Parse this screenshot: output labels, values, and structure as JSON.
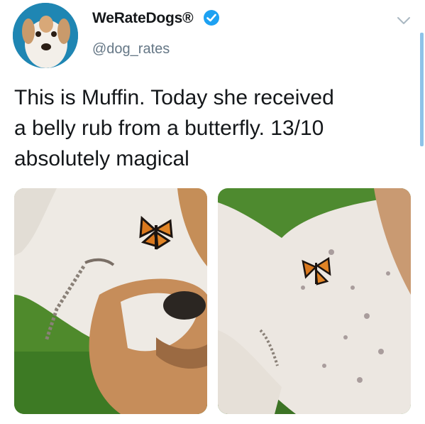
{
  "tweet": {
    "author": {
      "display_name": "WeRateDogs®",
      "handle": "@dog_rates",
      "verified": true,
      "avatar_icon": "dog-avatar"
    },
    "text_lines": [
      "This is Muffin. Today she received",
      "a belly rub from a butterfly. 13/10",
      "absolutely magical"
    ],
    "media": [
      {
        "icon": "dog-with-butterfly-photo"
      },
      {
        "icon": "dog-belly-butterfly-photo"
      }
    ]
  },
  "colors": {
    "accent": "#1da1f2",
    "text": "#14171a",
    "secondary_text": "#657786"
  }
}
